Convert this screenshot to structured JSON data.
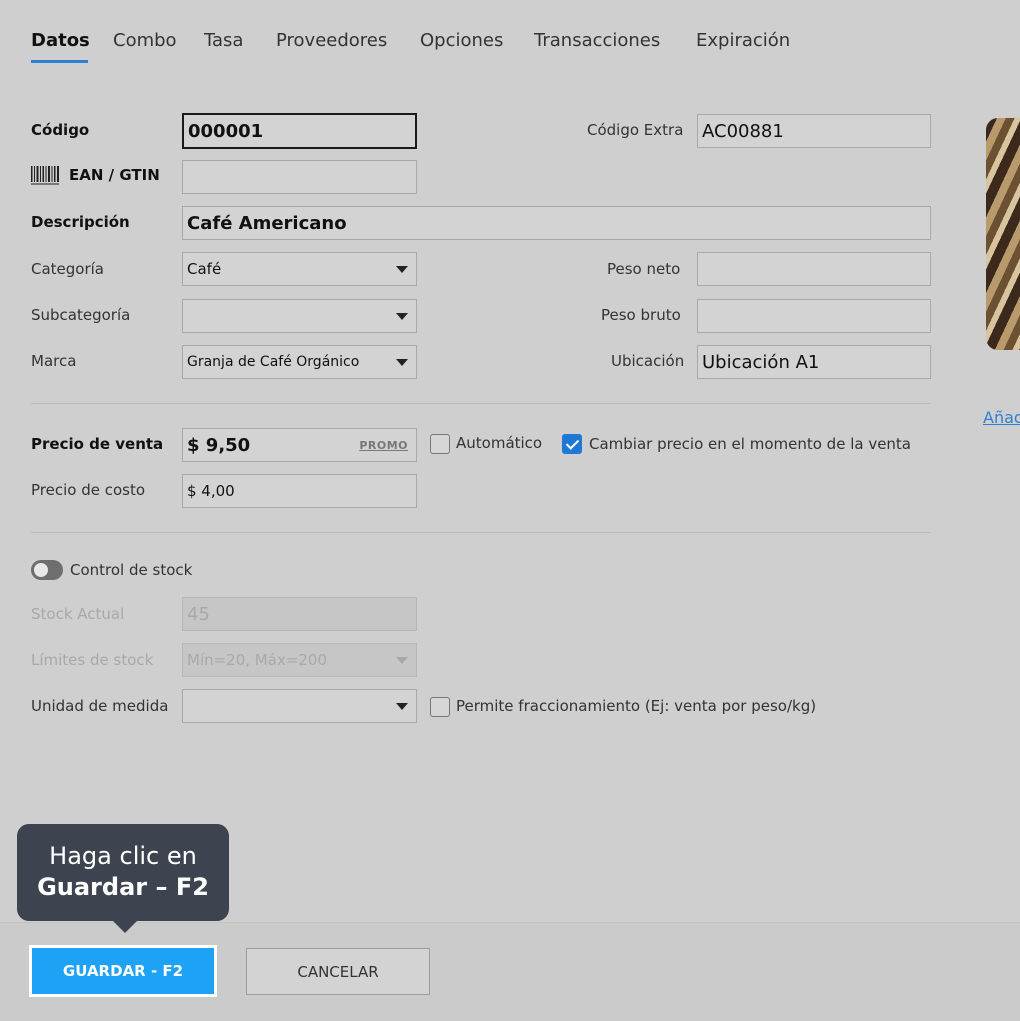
{
  "tabs": [
    {
      "label": "Datos",
      "active": true
    },
    {
      "label": "Combo"
    },
    {
      "label": "Tasa"
    },
    {
      "label": "Proveedores"
    },
    {
      "label": "Opciones"
    },
    {
      "label": "Transacciones"
    },
    {
      "label": "Expiración"
    }
  ],
  "form": {
    "codigo": {
      "label": "Código",
      "value": "000001"
    },
    "codigo_extra": {
      "label": "Código Extra",
      "value": "AC00881"
    },
    "ean": {
      "label": "EAN / GTIN",
      "value": ""
    },
    "descripcion": {
      "label": "Descripción",
      "value": "Café Americano"
    },
    "categoria": {
      "label": "Categoría",
      "value": "Café"
    },
    "subcategoria": {
      "label": "Subcategoría",
      "value": ""
    },
    "marca": {
      "label": "Marca",
      "value": "Granja de Café Orgánico"
    },
    "peso_neto": {
      "label": "Peso neto",
      "value": ""
    },
    "peso_bruto": {
      "label": "Peso bruto",
      "value": ""
    },
    "ubicacion": {
      "label": "Ubicación",
      "value": "Ubicación A1"
    },
    "precio_venta": {
      "label": "Precio de venta",
      "value": "$ 9,50",
      "promo": "PROMO"
    },
    "automatico": {
      "label": "Automático",
      "checked": false
    },
    "cambiar_precio": {
      "label": "Cambiar precio en el momento de la venta",
      "checked": true
    },
    "precio_costo": {
      "label": "Precio de costo",
      "value": "$ 4,00"
    },
    "control_stock": {
      "label": "Control de stock",
      "enabled": false
    },
    "stock_actual": {
      "label": "Stock Actual",
      "value": "45"
    },
    "limites_stock": {
      "label": "Límites de stock",
      "value": "Mín=20, Máx=200"
    },
    "unidad_medida": {
      "label": "Unidad de medida",
      "value": ""
    },
    "fraccionamiento": {
      "label": "Permite fraccionamiento (Ej: venta por peso/kg)",
      "checked": false
    }
  },
  "side": {
    "add_link": "Añad"
  },
  "tooltip": {
    "line1": "Haga clic en",
    "line2": "Guardar – F2"
  },
  "buttons": {
    "save": "GUARDAR - F2",
    "cancel": "CANCELAR"
  },
  "colors": {
    "accent": "#1ea2f6",
    "tab_underline": "#2f7fd4",
    "tooltip_bg": "#3d4450"
  }
}
